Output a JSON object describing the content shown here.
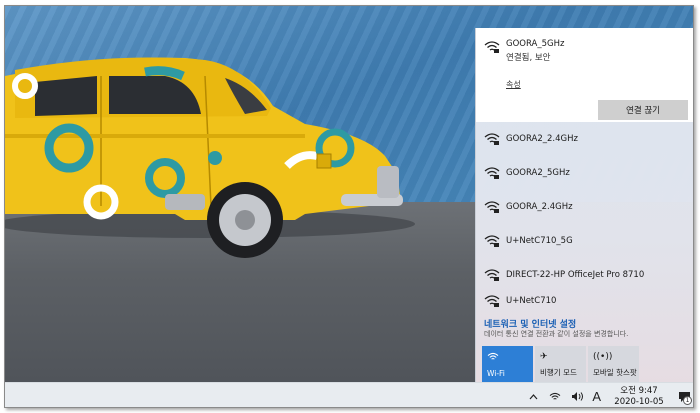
{
  "network": {
    "connected": {
      "name": "GOORA_5GHz",
      "status": "연결됨, 보안",
      "properties_link": "속성",
      "disconnect_label": "연결 끊기"
    },
    "available": [
      {
        "name": "GOORA2_2.4GHz",
        "secured": true
      },
      {
        "name": "GOORA2_5GHz",
        "secured": true
      },
      {
        "name": "GOORA_2.4GHz",
        "secured": true
      },
      {
        "name": "U+NetC710_5G",
        "secured": true
      },
      {
        "name": "DIRECT-22-HP OfficeJet Pro 8710",
        "secured": true
      },
      {
        "name": "U+NetC710",
        "secured": true
      }
    ],
    "settings_link": "네트워크 및 인터넷 설정",
    "settings_desc": "데이터 통신 연결 전환과 같이 설정을 변경합니다.",
    "quick_actions": [
      {
        "label": "Wi-Fi",
        "icon": "wifi-icon",
        "active": true
      },
      {
        "label": "비행기 모드",
        "icon": "airplane-icon",
        "active": false
      },
      {
        "label": "모바일 핫스팟",
        "icon": "hotspot-icon",
        "active": false
      }
    ]
  },
  "taskbar": {
    "ime_label": "A",
    "time": "오전 9:47",
    "date": "2020-10-05",
    "notification_count": "1",
    "icons": [
      "chevron-up-icon",
      "network-icon",
      "volume-icon"
    ]
  },
  "colors": {
    "accent": "#2d7fd6",
    "link": "#1a5fb4",
    "taskbar": "#e8ecf0"
  }
}
